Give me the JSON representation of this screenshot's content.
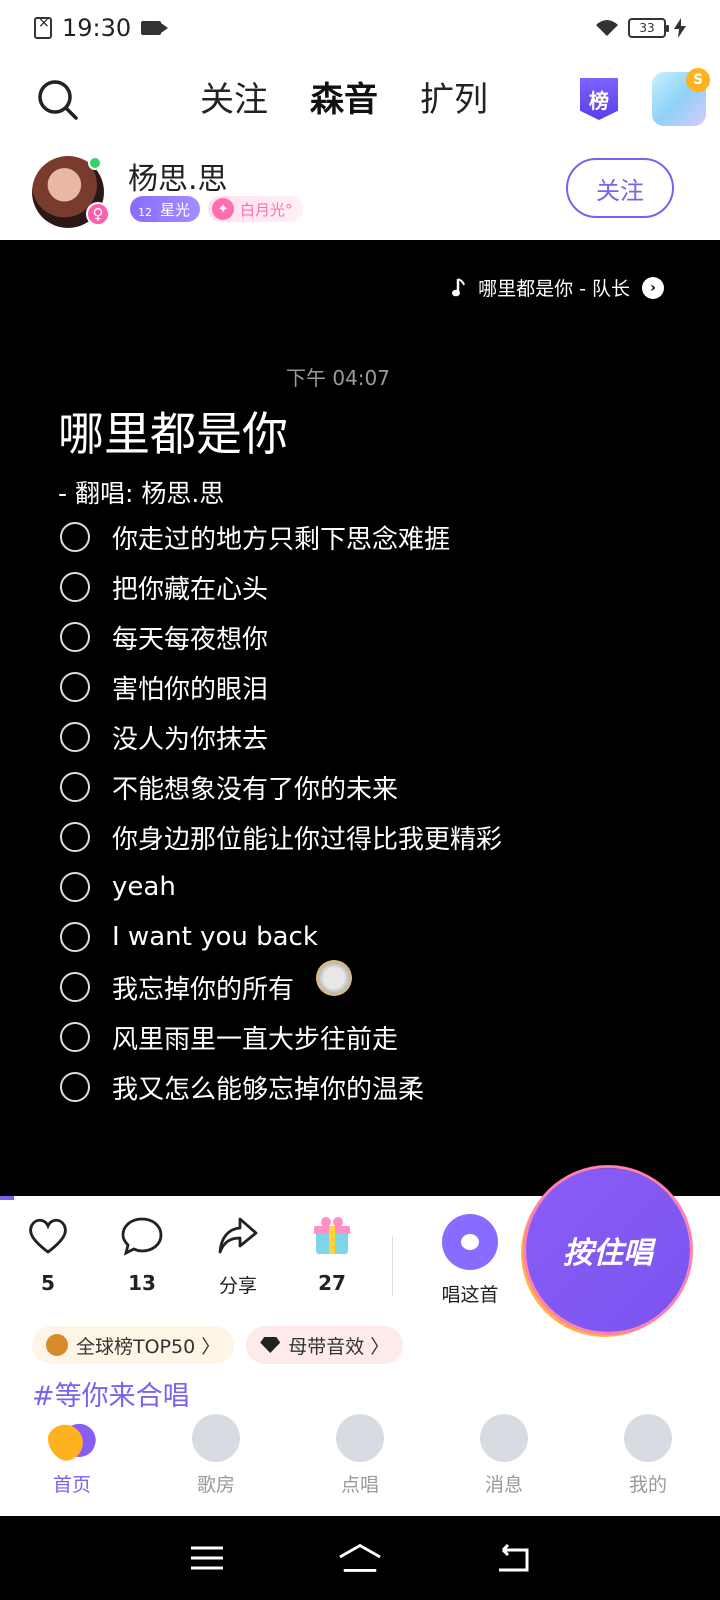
{
  "status_bar": {
    "time": "19:30",
    "battery": "33"
  },
  "top_nav": {
    "tabs": [
      {
        "label": "关注",
        "active": false
      },
      {
        "label": "森音",
        "active": true
      },
      {
        "label": "扩列",
        "active": false
      }
    ],
    "rank_label": "榜",
    "coin_label": "S"
  },
  "user": {
    "name": "杨思.思",
    "level": "12",
    "badge_star": "星光",
    "badge_moon": "白月光°",
    "follow_label": "关注",
    "gender_symbol": "♀"
  },
  "post": {
    "now_playing": "哪里都是你 - 队长",
    "timestamp": "下午 04:07",
    "song_title": "哪里都是你",
    "cover_line": "-  翻唱: 杨思.思",
    "lyrics": [
      "你走过的地方只剩下思念难捱",
      "把你藏在心头",
      "每天每夜想你",
      "害怕你的眼泪",
      "没人为你抹去",
      "不能想象没有了你的未来",
      "你身边那位能让你过得比我更精彩",
      "yeah",
      "I want you back",
      "我忘掉你的所有",
      "风里雨里一直大步往前走",
      "我又怎么能够忘掉你的温柔"
    ]
  },
  "actions": {
    "likes": "5",
    "comments": "13",
    "share_label": "分享",
    "gifts": "27",
    "sing_this_label": "唱这首",
    "hold_to_sing_label": "按住唱"
  },
  "tags": {
    "global_rank": "全球榜TOP50 〉",
    "sound_effect": "母带音效 〉",
    "hashtag": "#等你来合唱"
  },
  "bottom_nav": [
    {
      "label": "首页",
      "icon": "home-icon",
      "active": true
    },
    {
      "label": "歌房",
      "icon": "disco-ball-icon",
      "active": false
    },
    {
      "label": "点唱",
      "icon": "microphone-icon",
      "active": false
    },
    {
      "label": "消息",
      "icon": "message-icon",
      "active": false
    },
    {
      "label": "我的",
      "icon": "profile-icon",
      "active": false
    }
  ],
  "colors": {
    "accent": "#7a62f0",
    "tab_highlight": "#ffd43b",
    "panel_bg": "#000000"
  }
}
